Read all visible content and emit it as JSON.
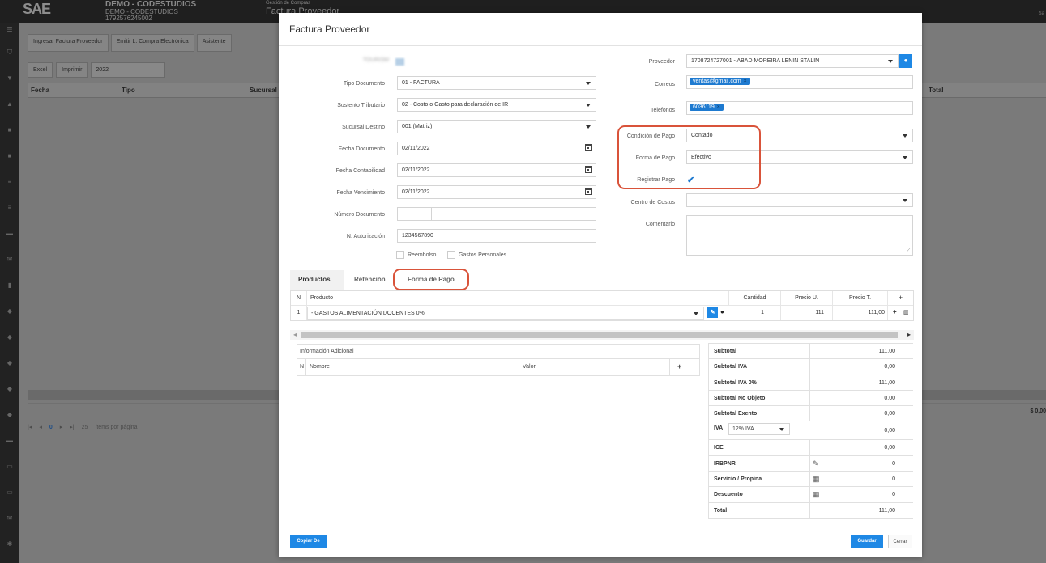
{
  "app": {
    "logo": "SAE",
    "logo_sub": "C L O U D",
    "company_name": "DEMO - CODESTUDIOS",
    "company_sub": "DEMO - CODESTUDIOS",
    "company_ruc": "1792576245002",
    "section": "Gestión de Compras",
    "page_title": "Factura Proveedor",
    "user": "Sa"
  },
  "background": {
    "toolbar": [
      "Ingresar Factura Proveedor",
      "Emitir L. Compra Electrónica",
      "Asistente"
    ],
    "excel": "Excel",
    "imprimir": "Imprimir",
    "year": "2022",
    "col_fecha": "Fecha",
    "col_tipo": "Tipo",
    "col_sucursal": "Sucursal",
    "col_total": "Total",
    "footer_total": "$ 0,00",
    "page_current": "0",
    "page_size": "25",
    "per_page_label": "ítems por página"
  },
  "modal": {
    "title": "Factura Proveedor",
    "blurred_label": "TOURISM",
    "left": {
      "tipo_documento": {
        "label": "Tipo Documento",
        "value": "01 - FACTURA"
      },
      "sustento": {
        "label": "Sustento Tributario",
        "value": "02 - Costo o Gasto para declaración de IR"
      },
      "sucursal": {
        "label": "Sucursal Destino",
        "value": "001 (Matriz)"
      },
      "fecha_documento": {
        "label": "Fecha Documento",
        "value": "02/11/2022"
      },
      "fecha_contable": {
        "label": "Fecha Contabilidad",
        "value": "02/11/2022"
      },
      "fecha_venc": {
        "label": "Fecha Vencimiento",
        "value": "02/11/2022"
      },
      "numero_doc": {
        "label": "Número Documento",
        "value1": "",
        "value2": ""
      },
      "autorizacion": {
        "label": "N. Autorización",
        "value": "1234567890"
      },
      "reembolso": "Reembolso",
      "gastos": "Gastos Personales"
    },
    "right": {
      "proveedor": {
        "label": "Proveedor",
        "value": "1708724727001 - ABAD MOREIRA LENIN STALIN"
      },
      "correos": {
        "label": "Correos",
        "tag": "ventas@gmail.com"
      },
      "telefonos": {
        "label": "Telefonos",
        "tag": "6036119"
      },
      "condicion": {
        "label": "Condición de Pago",
        "value": "Contado"
      },
      "forma": {
        "label": "Forma de Pago",
        "value": "Efectivo"
      },
      "registrar": {
        "label": "Registrar Pago",
        "checked": true
      },
      "centro": {
        "label": "Centro de Costos",
        "value": ""
      },
      "comentario": {
        "label": "Comentario",
        "value": ""
      }
    },
    "tabs": [
      "Productos",
      "Retención",
      "Forma de Pago"
    ],
    "products": {
      "headers": {
        "n": "N",
        "producto": "Producto",
        "cantidad": "Cantidad",
        "precio_u": "Precio U.",
        "precio_t": "Precio T.",
        "add": "+"
      },
      "rows": [
        {
          "n": "1",
          "producto": "- GASTOS ALIMENTACIÓN DOCENTES 0%",
          "cantidad": "1",
          "precio_u": "111",
          "precio_t": "111,00"
        }
      ]
    },
    "info_adicional": {
      "title": "Información Adicional",
      "n": "N",
      "nombre": "Nombre",
      "valor": "Valor",
      "add": "+"
    },
    "totals": [
      {
        "key": "Subtotal",
        "value": "111,00"
      },
      {
        "key": "Subtotal IVA",
        "value": "0,00"
      },
      {
        "key": "Subtotal IVA 0%",
        "value": "111,00"
      },
      {
        "key": "Subtotal No Objeto",
        "value": "0,00"
      },
      {
        "key": "Subtotal Exento",
        "value": "0,00"
      },
      {
        "key": "IVA",
        "value": "0,00",
        "select": "12% IVA"
      },
      {
        "key": "ICE",
        "value": "0,00"
      },
      {
        "key": "IRBPNR",
        "value": "0",
        "icon": "pencil-icon"
      },
      {
        "key": "Servicio / Propina",
        "value": "0",
        "icon": "calculator-icon"
      },
      {
        "key": "Descuento",
        "value": "0",
        "icon": "calculator-icon"
      },
      {
        "key": "Total",
        "value": "111,00"
      }
    ],
    "buttons": {
      "copiar": "Copiar De",
      "guardar": "Guardar",
      "cerrar": "Cerrar"
    }
  },
  "colors": {
    "accent": "#1e88e5",
    "highlight": "#d9533a",
    "tag": "#1e7ad0"
  }
}
